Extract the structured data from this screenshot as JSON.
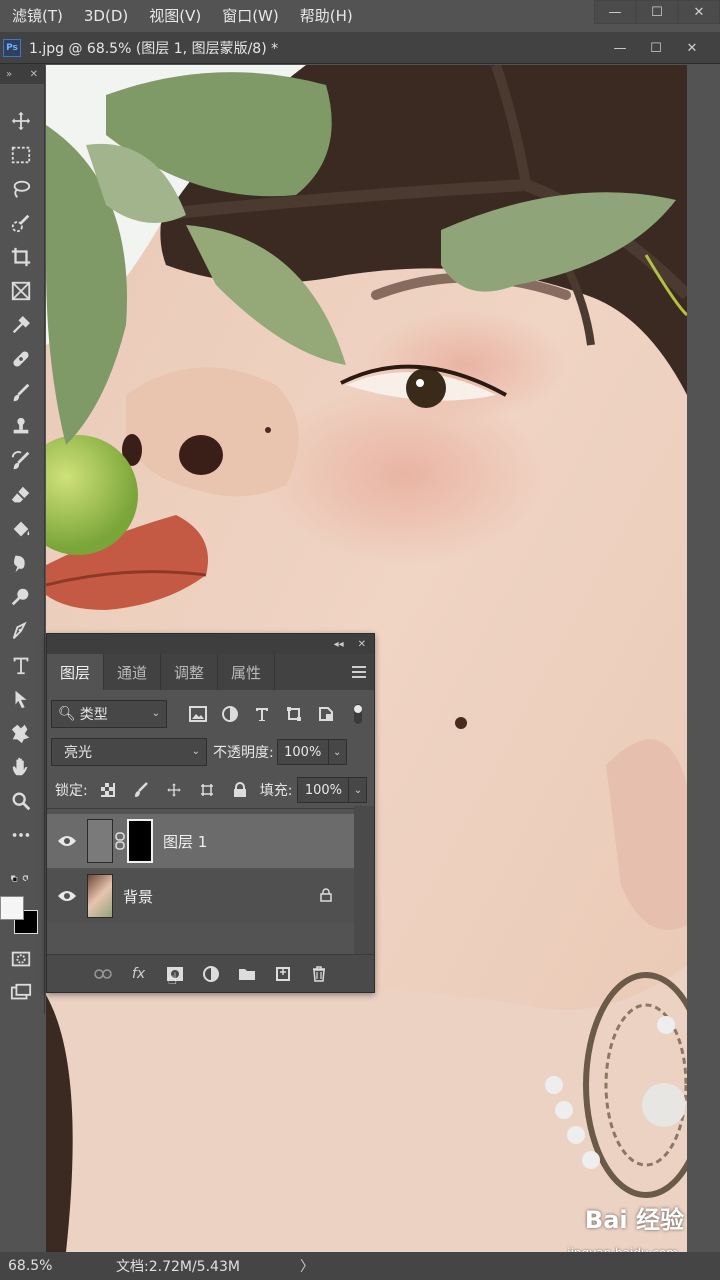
{
  "menubar": {
    "items": [
      "滤镜(T)",
      "3D(D)",
      "视图(V)",
      "窗口(W)",
      "帮助(H)"
    ]
  },
  "document": {
    "app_badge": "Ps",
    "title": "1.jpg @ 68.5% (图层 1, 图层蒙版/8) *"
  },
  "toolbar": {
    "tools": [
      "move-tool",
      "marquee-tool",
      "lasso-tool",
      "quick-select-tool",
      "crop-tool",
      "frame-tool",
      "eyedropper-tool",
      "healing-brush-tool",
      "brush-tool",
      "clone-stamp-tool",
      "history-brush-tool",
      "eraser-tool",
      "paint-bucket-tool",
      "smudge-tool",
      "dodge-tool",
      "pen-tool",
      "type-tool",
      "path-select-tool",
      "shape-tool",
      "hand-tool",
      "zoom-tool",
      "more-tools"
    ],
    "foreground_color": "#f5f5f5",
    "background_color": "#000000"
  },
  "layers_panel": {
    "tabs": [
      "图层",
      "通道",
      "调整",
      "属性"
    ],
    "active_tab": "图层",
    "filter": {
      "label": "类型"
    },
    "blend_mode": "亮光",
    "opacity_label": "不透明度:",
    "opacity": "100%",
    "lock_label": "锁定:",
    "fill_label": "填充:",
    "fill": "100%",
    "layers": [
      {
        "name": "图层 1",
        "visible": true,
        "selected": true,
        "has_mask": true
      },
      {
        "name": "背景",
        "visible": true,
        "selected": false,
        "locked": true
      }
    ],
    "bottom_actions": [
      "link-layers",
      "add-layer-style",
      "add-mask",
      "adjustment-layer",
      "new-group",
      "new-layer",
      "delete-layer"
    ]
  },
  "status": {
    "zoom": "68.5%",
    "doc_size": "文档:2.72M/5.43M",
    "arrow": "〉"
  },
  "watermark": {
    "brand": "Bai 经验",
    "url": "jingyan.baidu.com"
  }
}
